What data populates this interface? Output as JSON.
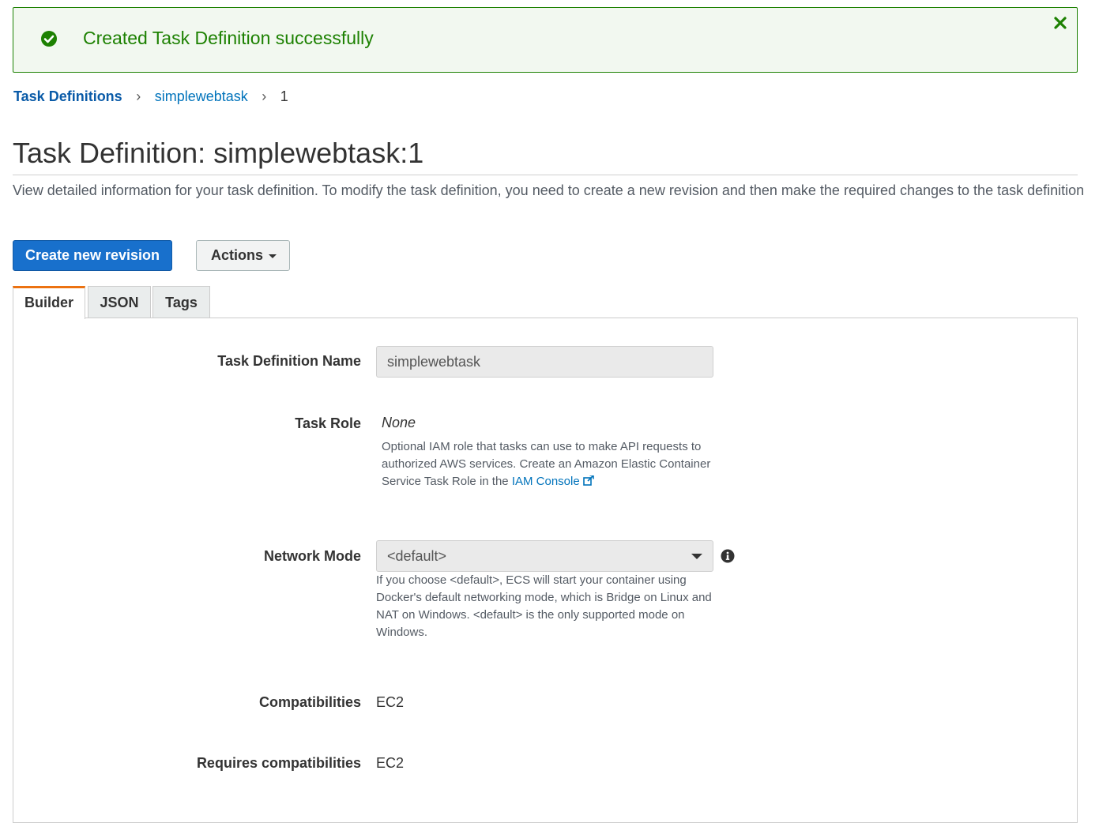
{
  "alert": {
    "message": "Created Task Definition successfully",
    "status_icon": "check-circle-icon",
    "close_icon": "close-icon",
    "color": "#1d8102"
  },
  "breadcrumb": {
    "items": [
      "Task Definitions",
      "simplewebtask",
      "1"
    ],
    "separator": "›"
  },
  "page": {
    "title": "Task Definition: simplewebtask:1",
    "description": "View detailed information for your task definition. To modify the task definition, you need to create a new revision and then make the required changes to the task definition"
  },
  "toolbar": {
    "create_label": "Create new revision",
    "actions_label": "Actions"
  },
  "tabs": [
    {
      "label": "Builder",
      "active": true
    },
    {
      "label": "JSON",
      "active": false
    },
    {
      "label": "Tags",
      "active": false
    }
  ],
  "form": {
    "name": {
      "label": "Task Definition Name",
      "value": "simplewebtask"
    },
    "task_role": {
      "label": "Task Role",
      "value": "None",
      "help_prefix": "Optional IAM role that tasks can use to make API requests to authorized AWS services. Create an Amazon Elastic Container Service Task Role in the",
      "help_link": "IAM Console"
    },
    "network_mode": {
      "label": "Network Mode",
      "value": "<default>",
      "help": "If you choose <default>, ECS will start your container using Docker's default networking mode, which is Bridge on Linux and NAT on Windows. <default> is the only supported mode on Windows."
    },
    "compatibilities": {
      "label": "Compatibilities",
      "value": "EC2"
    },
    "requires_compatibilities": {
      "label": "Requires compatibilities",
      "value": "EC2"
    }
  },
  "colors": {
    "primary_button": "#1870cc",
    "link": "#0073bb",
    "active_tab_accent": "#ec7211"
  }
}
